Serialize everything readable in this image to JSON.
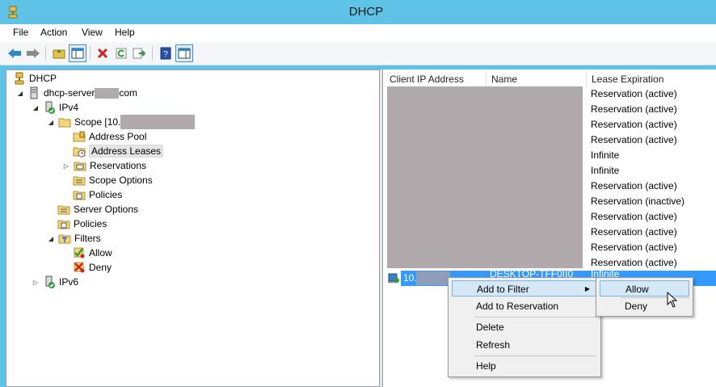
{
  "window": {
    "title": "DHCP"
  },
  "menubar": {
    "items": [
      "File",
      "Action",
      "View",
      "Help"
    ]
  },
  "toolbar": {
    "buttons": [
      "back-icon",
      "forward-icon",
      "up-folder-icon",
      "console-tree-icon",
      "delete-icon",
      "refresh-icon",
      "export-icon",
      "help-icon",
      "action-pane-icon"
    ]
  },
  "tree": {
    "root": "DHCP",
    "server": {
      "prefix": "dhcp-server",
      "suffix": "com"
    },
    "ipv4": "IPv4",
    "scope": "Scope [10.",
    "address_pool": "Address Pool",
    "address_leases": "Address Leases",
    "reservations": "Reservations",
    "scope_options": "Scope Options",
    "scope_policies": "Policies",
    "server_options": "Server Options",
    "policies": "Policies",
    "filters": "Filters",
    "allow": "Allow",
    "deny": "Deny",
    "ipv6": "IPv6"
  },
  "list": {
    "columns": [
      "Client IP Address",
      "Name",
      "Lease Expiration"
    ],
    "lease_expirations": [
      "Reservation (active)",
      "Reservation (active)",
      "Reservation (active)",
      "Reservation (active)",
      "Infinite",
      "Infinite",
      "Reservation (active)",
      "Reservation (inactive)",
      "Reservation (active)",
      "Reservation (active)",
      "Reservation (active)",
      "Reservation (active)"
    ],
    "selected_row": {
      "ip": "10.",
      "name": "DESKTOP-TFF0II0",
      "expiration": "Infinite"
    }
  },
  "context_menu": {
    "items": [
      "Add to Filter",
      "Add to Reservation",
      "Delete",
      "Refresh",
      "Help"
    ]
  },
  "submenu": {
    "items": [
      "Allow",
      "Deny"
    ]
  },
  "colors": {
    "titlebar": "#5ec3e6",
    "selection": "#3399ff",
    "redaction": "#b0aaac"
  }
}
